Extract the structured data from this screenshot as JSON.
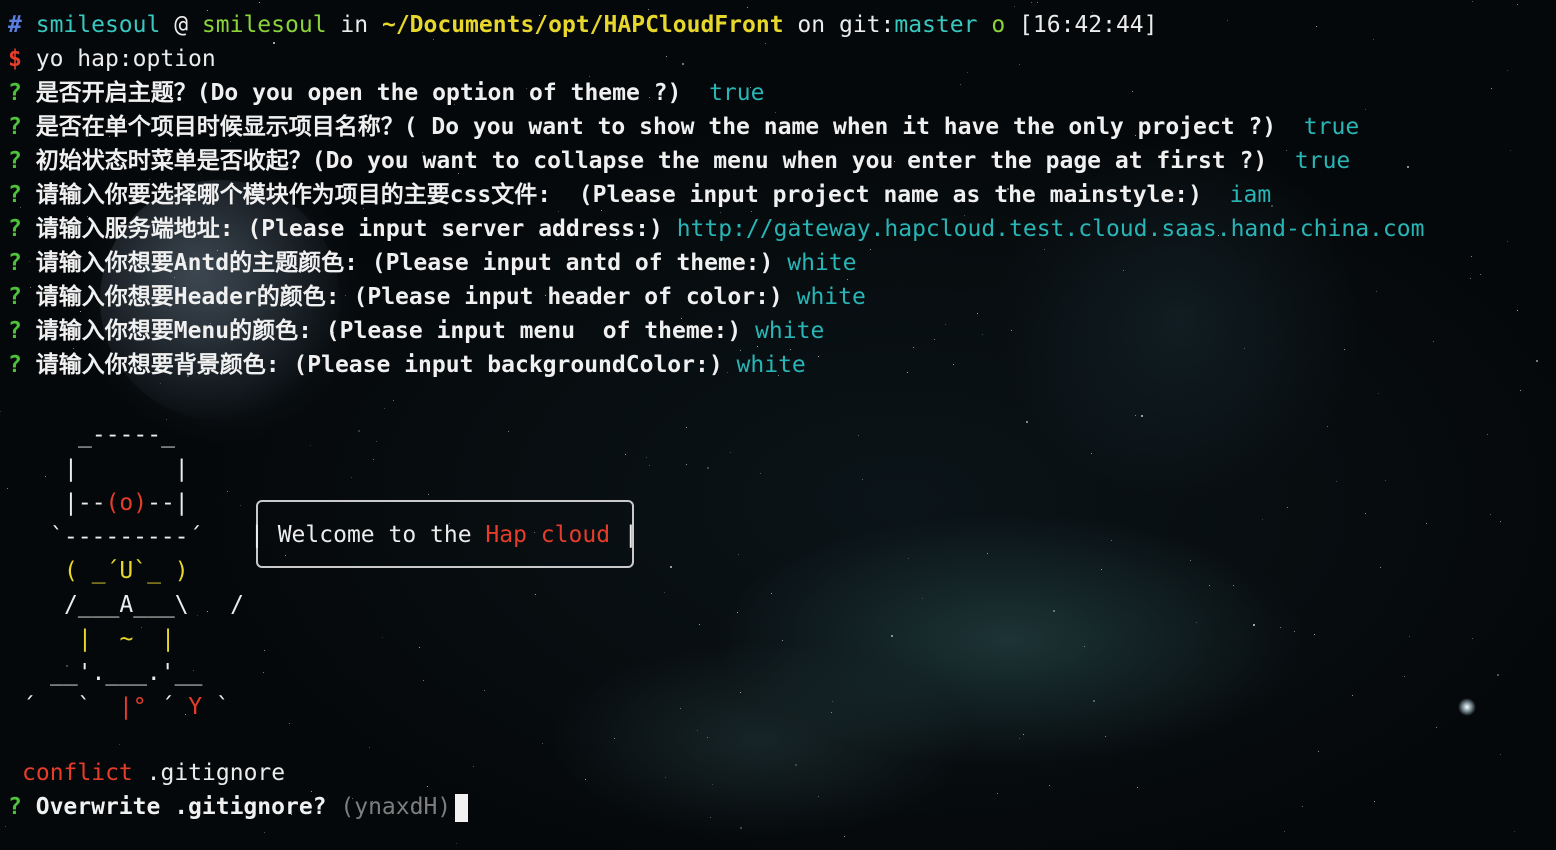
{
  "prompt": {
    "hash": "#",
    "user": "smilesoul",
    "at": "@",
    "host": "smilesoul",
    "in": "in",
    "path": "~/Documents/opt/HAPCloudFront",
    "on": "on",
    "git_label": "git:",
    "branch": "master",
    "status": "o",
    "time": "[16:42:44]"
  },
  "command": {
    "dollar": "$",
    "text": "yo hap:option"
  },
  "questions": [
    {
      "mark": "?",
      "text": "是否开启主题？(Do you open the option of theme ?)  ",
      "answer": "true"
    },
    {
      "mark": "?",
      "text": "是否在单个项目时候显示项目名称？( Do you want to show the name when it have the only project ?)  ",
      "answer": "true"
    },
    {
      "mark": "?",
      "text": "初始状态时菜单是否收起？(Do you want to collapse the menu when you enter the page at first ?)  ",
      "answer": "true"
    },
    {
      "mark": "?",
      "text": "请输入你要选择哪个模块作为项目的主要css文件:  (Please input project name as the mainstyle:)  ",
      "answer": "iam"
    },
    {
      "mark": "?",
      "text": "请输入服务端地址: (Please input server address:) ",
      "answer": "http://gateway.hapcloud.test.cloud.saas.hand-china.com"
    },
    {
      "mark": "?",
      "text": "请输入你想要Antd的主题颜色: (Please input antd of theme:) ",
      "answer": "white"
    },
    {
      "mark": "?",
      "text": "请输入你想要Header的颜色: (Please input header of color:) ",
      "answer": "white"
    },
    {
      "mark": "?",
      "text": "请输入你想要Menu的颜色: (Please input menu  of theme:) ",
      "answer": "white"
    },
    {
      "mark": "?",
      "text": "请输入你想要背景颜色: (Please input backgroundColor:) ",
      "answer": "white"
    }
  ],
  "robot": {
    "hat_top": "_-----_",
    "hat_side": "|       |",
    "eye_left": "|--",
    "eye": "(o)",
    "eye_right": "--|",
    "brim": "`---------´",
    "face": "( _´U`_ )",
    "body": "/___A___\\   /",
    "belly": "|  ~  |",
    "legs": "__'.___.'__",
    "feet_a": "´   `  ",
    "feet_b": "|° ",
    "feet_c": "´ ",
    "feet_d": "Y",
    "feet_e": " `"
  },
  "welcome": {
    "prefix": "Welcome to the ",
    "brand": "Hap cloud"
  },
  "conflict": {
    "label": "conflict",
    "file": ".gitignore"
  },
  "overwrite": {
    "mark": "?",
    "text": "Overwrite .gitignore?",
    "options": "(ynaxdH)"
  },
  "colors": {
    "question_mark": "#4fc23c",
    "answer": "#29b5b5",
    "error": "#e53d2a",
    "user": "#8ad33a",
    "path": "#e7d62c"
  }
}
